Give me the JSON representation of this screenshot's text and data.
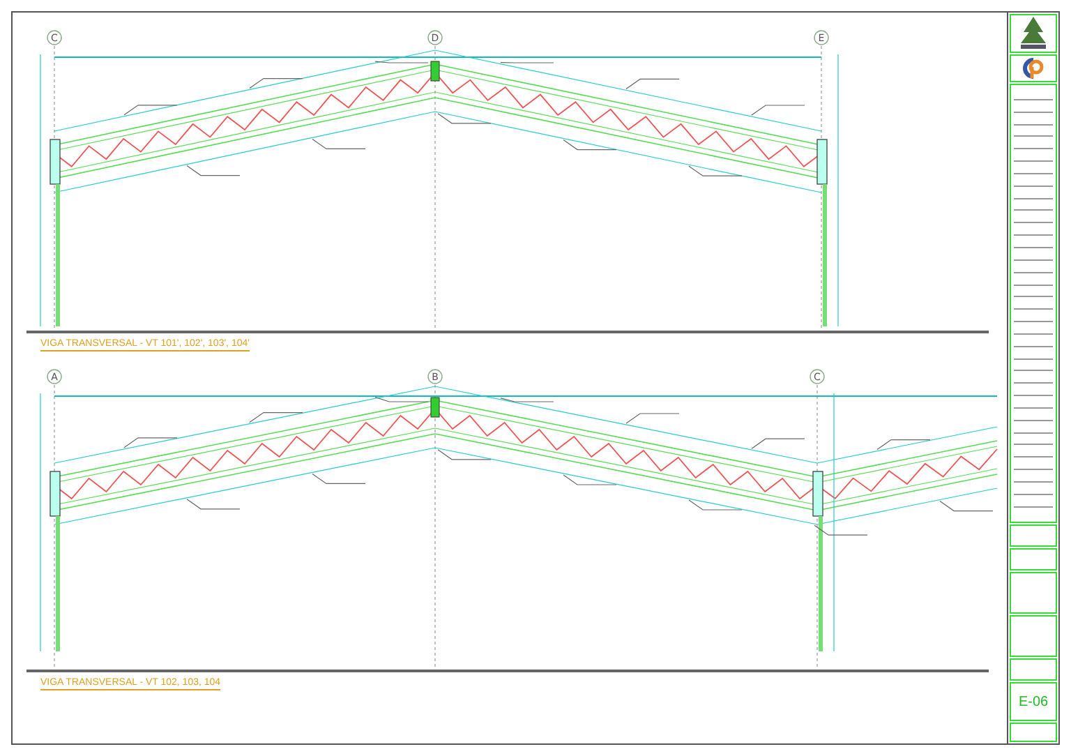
{
  "elevations": [
    {
      "grid_lines": [
        {
          "label": "C"
        },
        {
          "label": "D"
        },
        {
          "label": "E"
        }
      ],
      "title": "VIGA TRANSVERSAL - VT 101', 102', 103', 104'"
    },
    {
      "grid_lines": [
        {
          "label": "A"
        },
        {
          "label": "B"
        },
        {
          "label": "C"
        }
      ],
      "title": "VIGA TRANSVERSAL - VT 102, 103, 104"
    }
  ],
  "title_block": {
    "sheet_number": "E-06"
  }
}
